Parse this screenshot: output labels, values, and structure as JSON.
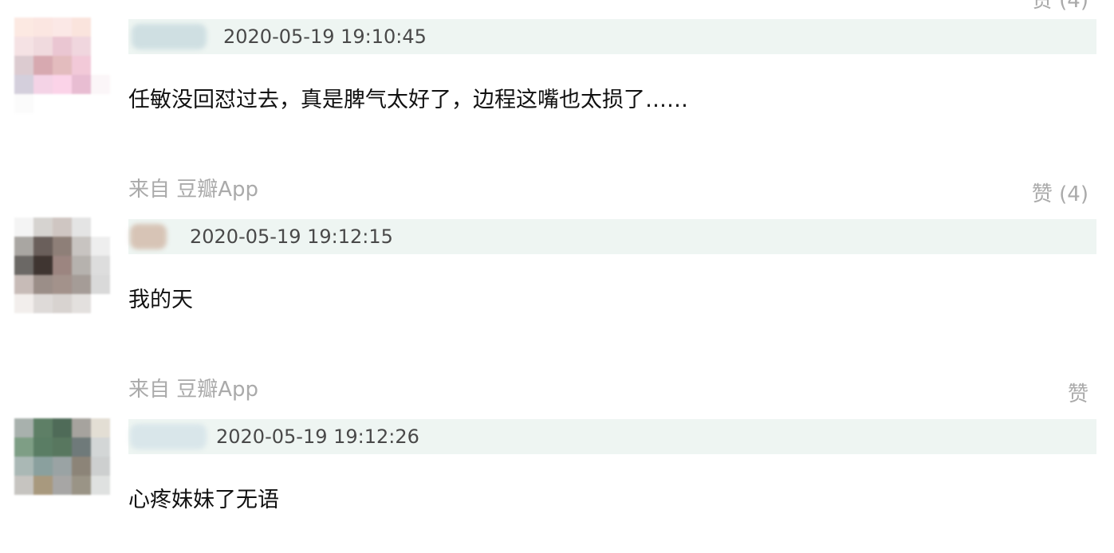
{
  "comments": [
    {
      "timestamp": "2020-05-19 19:10:45",
      "text": "任敏没回怼过去，真是脾气太好了，边程这嘴也太损了……",
      "source": "来自 豆瓣App",
      "like_label": "赞 (4)",
      "avatar_colors": [
        [
          "#fce9e2",
          "#fbe6e1",
          "#fbe8e6",
          "#fae4dd",
          "#ffffff"
        ],
        [
          "#f5e2e4",
          "#f0dade",
          "#eac6d2",
          "#f0d6de",
          "#ffffff"
        ],
        [
          "#dccbd0",
          "#d7a9b0",
          "#e3bcbe",
          "#f2c9d8",
          "#ffffff"
        ],
        [
          "#d4cfdc",
          "#f4d3e6",
          "#fbd3e8",
          "#e8bdd2",
          "#fbf6f8"
        ],
        [
          "#fbfbfb",
          "#ffffff",
          "#ffffff",
          "#ffffff",
          "#ffffff"
        ]
      ],
      "author_blur_color": "#cfdfe2"
    },
    {
      "timestamp": "2020-05-19 19:12:15",
      "text": "我的天",
      "source": "来自 豆瓣App",
      "like_label": "赞",
      "avatar_colors": [
        [
          "#f4f4f4",
          "#d6d3d0",
          "#cfc6c2",
          "#e4e4e4",
          "#ffffff"
        ],
        [
          "#a9a6a2",
          "#6a5f5b",
          "#8e7f78",
          "#c8c4c1",
          "#eeeeee"
        ],
        [
          "#6b6865",
          "#3f3531",
          "#9c8580",
          "#b6b2ae",
          "#dddddd"
        ],
        [
          "#c7bbb7",
          "#9b8e88",
          "#a3928b",
          "#a59c97",
          "#d9d9d9"
        ],
        [
          "#f2eeec",
          "#dedad8",
          "#d8d3d0",
          "#e3e0de",
          "#ffffff"
        ]
      ],
      "author_blur_color": "#d7c4b6"
    },
    {
      "timestamp": "2020-05-19 19:12:26",
      "text": "心疼妹妹了无语",
      "source": "",
      "like_label": "",
      "avatar_colors": [
        [
          "#a8b1ad",
          "#5e7f66",
          "#4f6b58",
          "#a6a39e",
          "#e3ded4"
        ],
        [
          "#7e9e85",
          "#5a7d64",
          "#58775f",
          "#6f7a7a",
          "#d3d6d6"
        ],
        [
          "#aab8b5",
          "#8aa09e",
          "#9aa3a4",
          "#8c8478",
          "#cdcfcf"
        ],
        [
          "#c6c4c0",
          "#a8997e",
          "#a7a6a5",
          "#9a9486",
          "#dfe1e0"
        ],
        [
          "#ffffff",
          "#ffffff",
          "#ffffff",
          "#ffffff",
          "#ffffff"
        ]
      ],
      "author_blur_color": "#d9e6ea"
    }
  ]
}
